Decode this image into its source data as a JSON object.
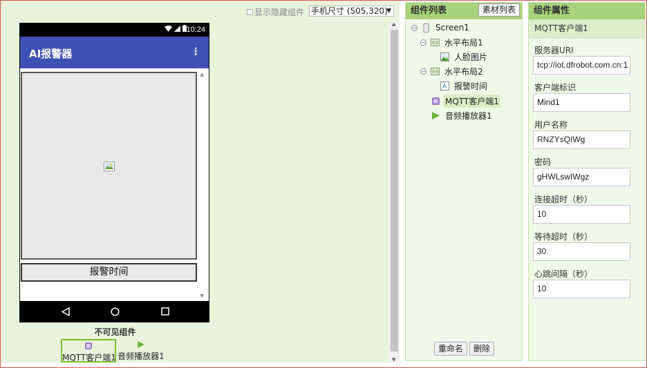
{
  "toolbar": {
    "show_hidden_label": "显示隐藏组件",
    "screen_size_value": "手机尺寸 (505,320)",
    "dropdown_arrow": "▼"
  },
  "phone": {
    "status_time": "10:24",
    "app_title": "AI报警器",
    "overflow_menu": "⋮",
    "label_text": "报警时间",
    "nav_icons": [
      "back-icon",
      "home-icon",
      "recents-icon"
    ]
  },
  "nonvisible": {
    "title": "不可见组件",
    "items": [
      {
        "label": "MQTT客户端1",
        "icon": "mqtt-icon",
        "selected": true
      },
      {
        "label": "音频播放器1",
        "icon": "player-icon",
        "selected": false
      }
    ]
  },
  "components": {
    "title": "组件列表",
    "assets_button": "素材列表",
    "tree": [
      {
        "label": "Screen1",
        "icon": "screen-icon",
        "toggle": "⊖"
      },
      {
        "label": "水平布局1",
        "icon": "layout-icon",
        "toggle": "⊖"
      },
      {
        "label": "人脸图片",
        "icon": "image-icon"
      },
      {
        "label": "水平布局2",
        "icon": "layout-icon",
        "toggle": "⊖"
      },
      {
        "label": "报警时间",
        "icon": "label-icon"
      },
      {
        "label": "MQTT客户端1",
        "icon": "mqtt-icon",
        "selected": true
      },
      {
        "label": "音频播放器1",
        "icon": "player-icon"
      }
    ],
    "rename_button": "重命名",
    "delete_button": "删除"
  },
  "properties": {
    "title": "组件属性",
    "component_name": "MQTT客户端1",
    "fields": [
      {
        "label": "服务器URI",
        "value": "tcp://iot.dfrobot.com.cn:1"
      },
      {
        "label": "客户端标识",
        "value": "Mind1"
      },
      {
        "label": "用户名称",
        "value": "RNZYsQIWg"
      },
      {
        "label": "密码",
        "value": "gHWLswIWgz"
      },
      {
        "label": "连接超时（秒）",
        "value": "10"
      },
      {
        "label": "等待超时（秒）",
        "value": "30"
      },
      {
        "label": "心跳间隔（秒）",
        "value": "10"
      }
    ]
  },
  "colors": {
    "viewer_bg": "#e9f3dc",
    "panel_header": "#a9d27c",
    "appbar": "#3f51b5",
    "selection": "#7cbd29"
  }
}
